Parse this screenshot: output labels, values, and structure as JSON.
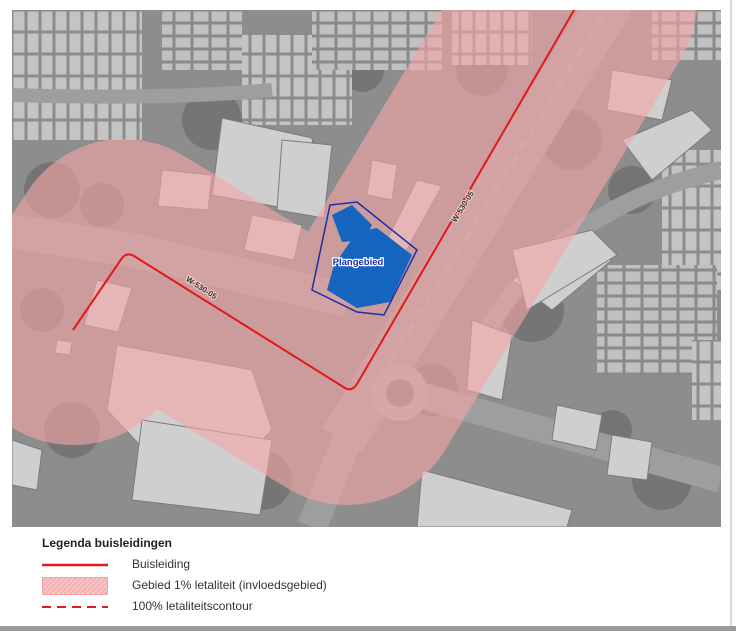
{
  "map": {
    "labels": {
      "plangebied": "Plangebied",
      "pipeline_north": "W-530-05",
      "pipeline_west": "W-530-05"
    },
    "colors": {
      "pipeline": "#e0191c",
      "impact_zone": "#f4a5a5",
      "plan_area_fill": "#1565c0",
      "plan_area_outline": "#1a2fa8",
      "label_text": "#1a2fa8"
    }
  },
  "legend": {
    "title": "Legenda buisleidingen",
    "items": [
      {
        "label": "Buisleiding",
        "symbol": "solid-line"
      },
      {
        "label": "Gebied 1% letaliteit (invloedsgebied)",
        "symbol": "hatched-fill"
      },
      {
        "label": "100% letaliteitscontour",
        "symbol": "dashed-line"
      }
    ]
  }
}
